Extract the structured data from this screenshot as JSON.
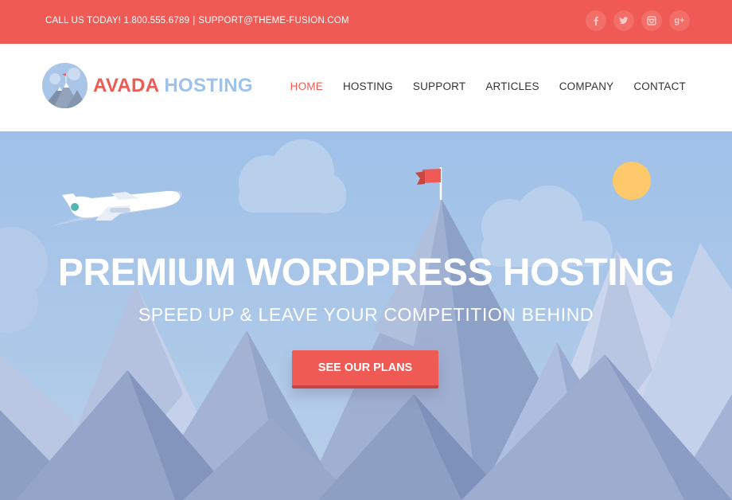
{
  "topbar": {
    "phone_text": "CALL US TODAY! 1.800.555.6789",
    "separator": "|",
    "email_text": "SUPPORT@THEME-FUSION.COM",
    "socials": [
      {
        "icon": "facebook-icon",
        "glyph": "f"
      },
      {
        "icon": "twitter-icon",
        "glyph": ""
      },
      {
        "icon": "instagram-icon",
        "glyph": ""
      },
      {
        "icon": "google-plus-icon",
        "glyph": "g+"
      }
    ],
    "background_color": "#ef5a55"
  },
  "logo": {
    "word1": "AVADA",
    "word2": "HOSTING",
    "word1_color": "#ef5a55",
    "word2_color": "#9ec2ea"
  },
  "nav": {
    "items": [
      {
        "label": "HOME",
        "active": true
      },
      {
        "label": "HOSTING",
        "active": false
      },
      {
        "label": "SUPPORT",
        "active": false
      },
      {
        "label": "ARTICLES",
        "active": false
      },
      {
        "label": "COMPANY",
        "active": false
      },
      {
        "label": "CONTACT",
        "active": false
      }
    ]
  },
  "hero": {
    "title": "PREMIUM WORDPRESS HOSTING",
    "subtitle": "SPEED UP & LEAVE YOUR COMPETITION BEHIND",
    "cta_label": "SEE OUR PLANS",
    "sky_color": "#a7c5e7",
    "accent_color": "#ef5a55",
    "sun_color": "#fdc96a"
  }
}
